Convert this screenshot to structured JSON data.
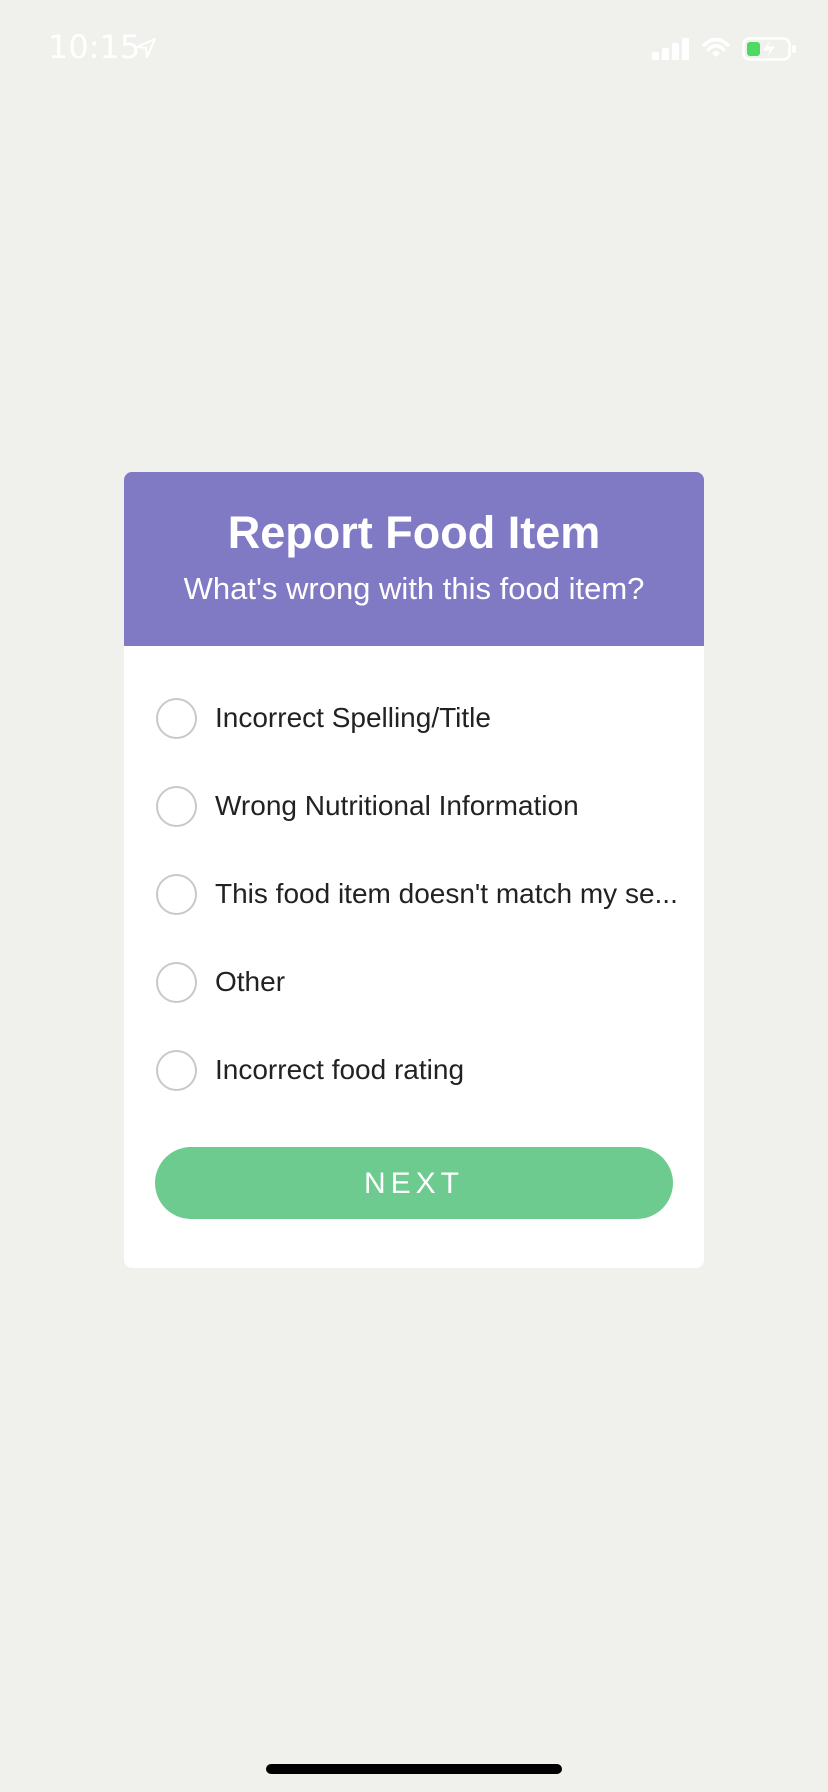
{
  "status_bar": {
    "time": "10:15",
    "icons": [
      "location-arrow-icon",
      "cellular-signal-icon",
      "wifi-icon",
      "battery-charging-icon"
    ]
  },
  "dialog": {
    "title": "Report Food Item",
    "subtitle": "What's wrong with this food item?",
    "options": [
      {
        "label": "Incorrect Spelling/Title",
        "selected": false
      },
      {
        "label": "Wrong Nutritional Information",
        "selected": false
      },
      {
        "label": "This food item doesn't match my se...",
        "selected": false
      },
      {
        "label": "Other",
        "selected": false
      },
      {
        "label": "Incorrect food rating",
        "selected": false
      }
    ],
    "next_label": "NEXT"
  },
  "colors": {
    "background": "#f0f0ec",
    "header": "#8079c4",
    "button": "#6dcb90",
    "radio_border": "#c9c9c9",
    "battery_fill": "#4cd964"
  }
}
